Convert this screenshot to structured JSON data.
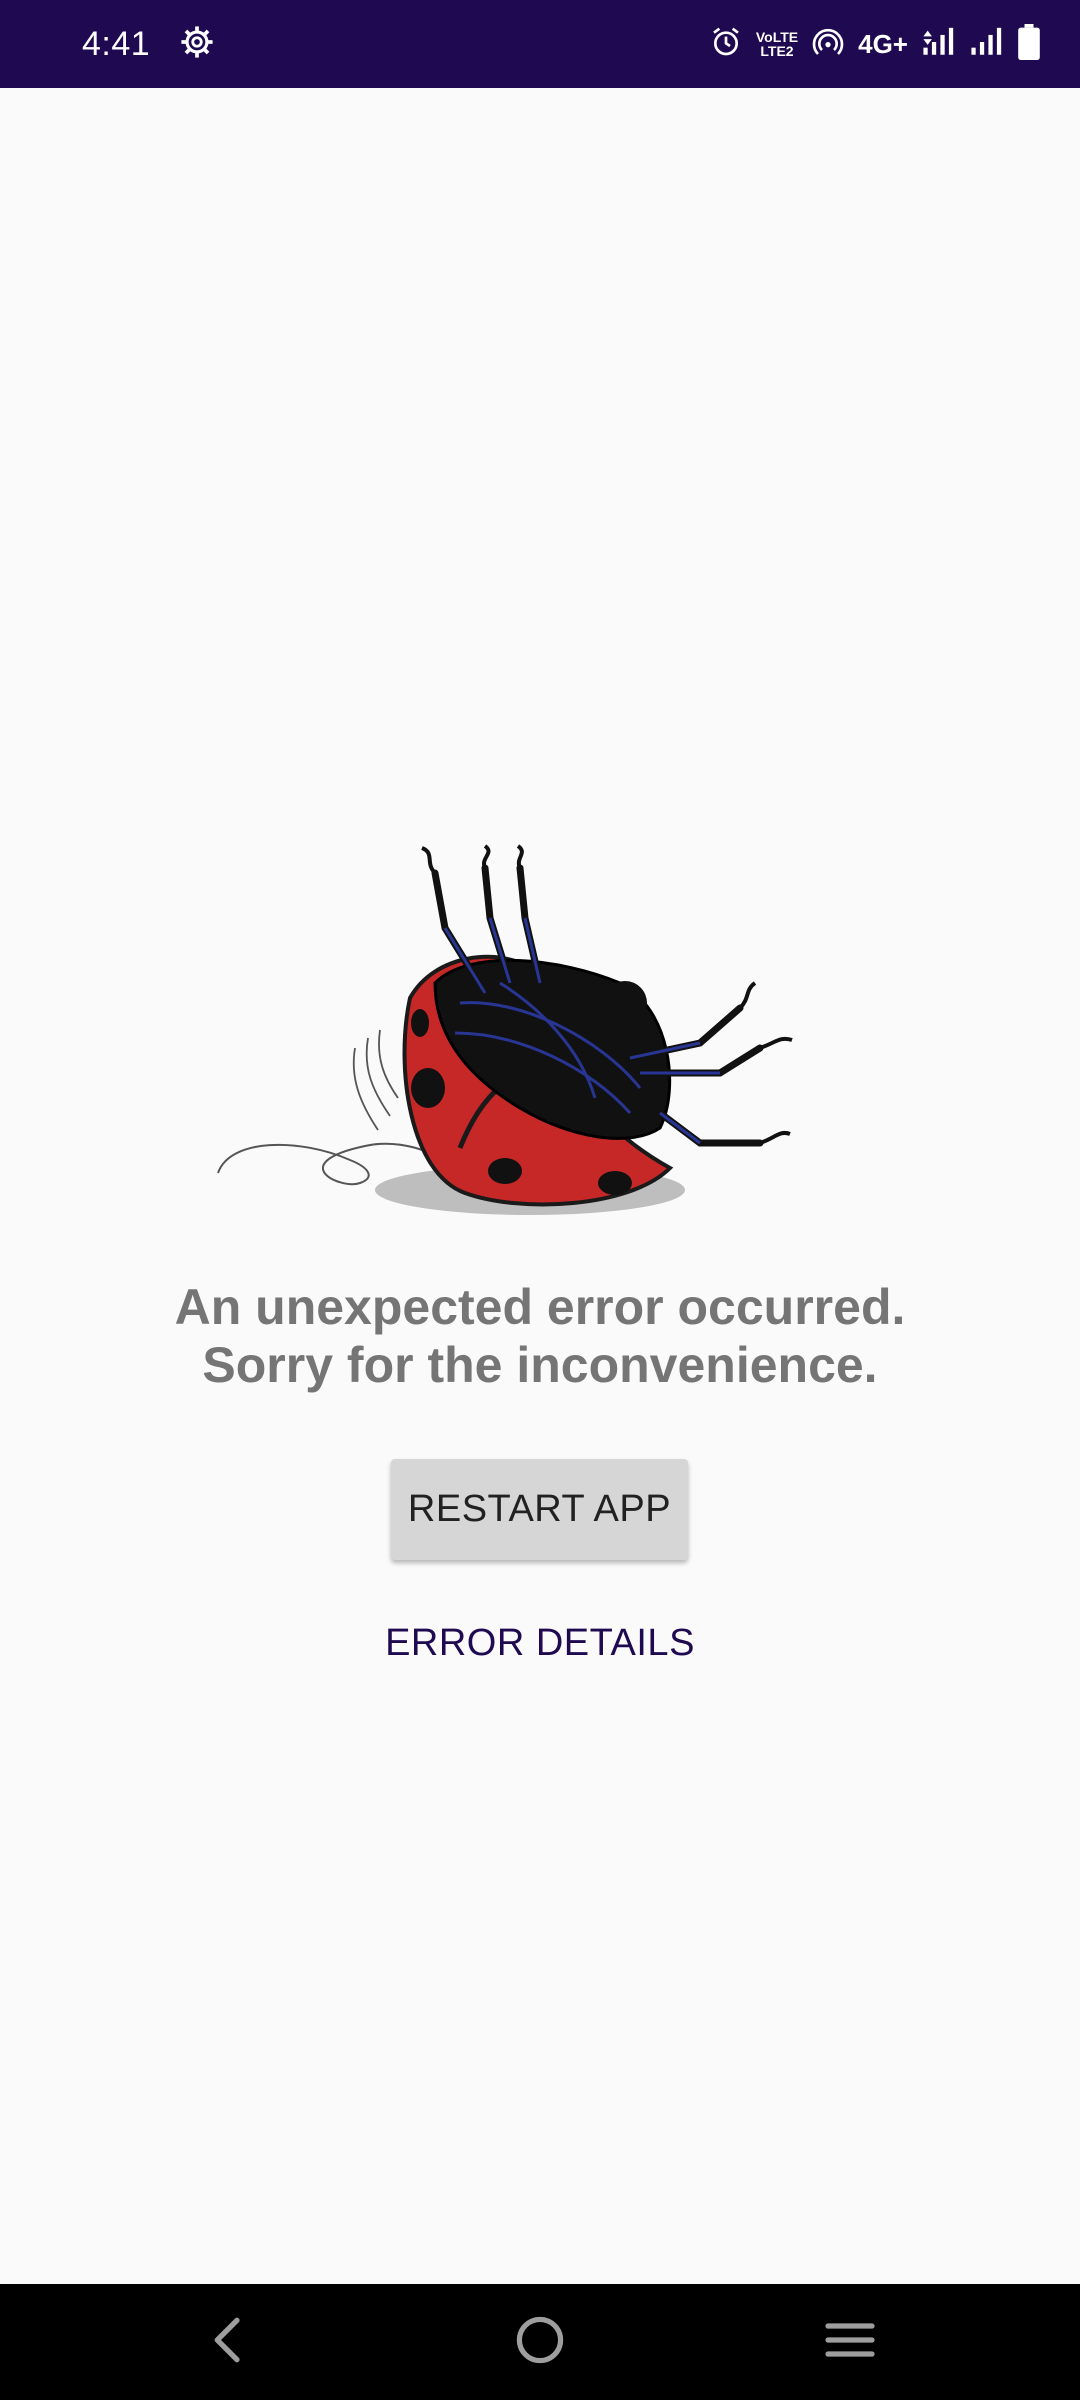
{
  "status_bar": {
    "time": "4:41",
    "volte_top": "VoLTE",
    "volte_bottom": "LTE2",
    "network": "4G+",
    "colors": {
      "background": "#1f0a52",
      "foreground": "#ffffff"
    },
    "icons": [
      "settings-gear-icon",
      "alarm-icon",
      "hotspot-icon",
      "signal-sim1-icon",
      "signal-sim2-icon",
      "battery-icon"
    ]
  },
  "error_screen": {
    "message_line1": "An unexpected error occurred.",
    "message_line2": "Sorry for the inconvenience.",
    "restart_label": "RESTART APP",
    "details_label": "ERROR DETAILS",
    "illustration": "upside-down-ladybug-illustration",
    "colors": {
      "message": "#757575",
      "details_link": "#1f0a52",
      "button_bg": "#d6d6d6"
    }
  },
  "nav_bar": {
    "icons": [
      "back-icon",
      "home-icon",
      "recents-menu-icon"
    ]
  }
}
